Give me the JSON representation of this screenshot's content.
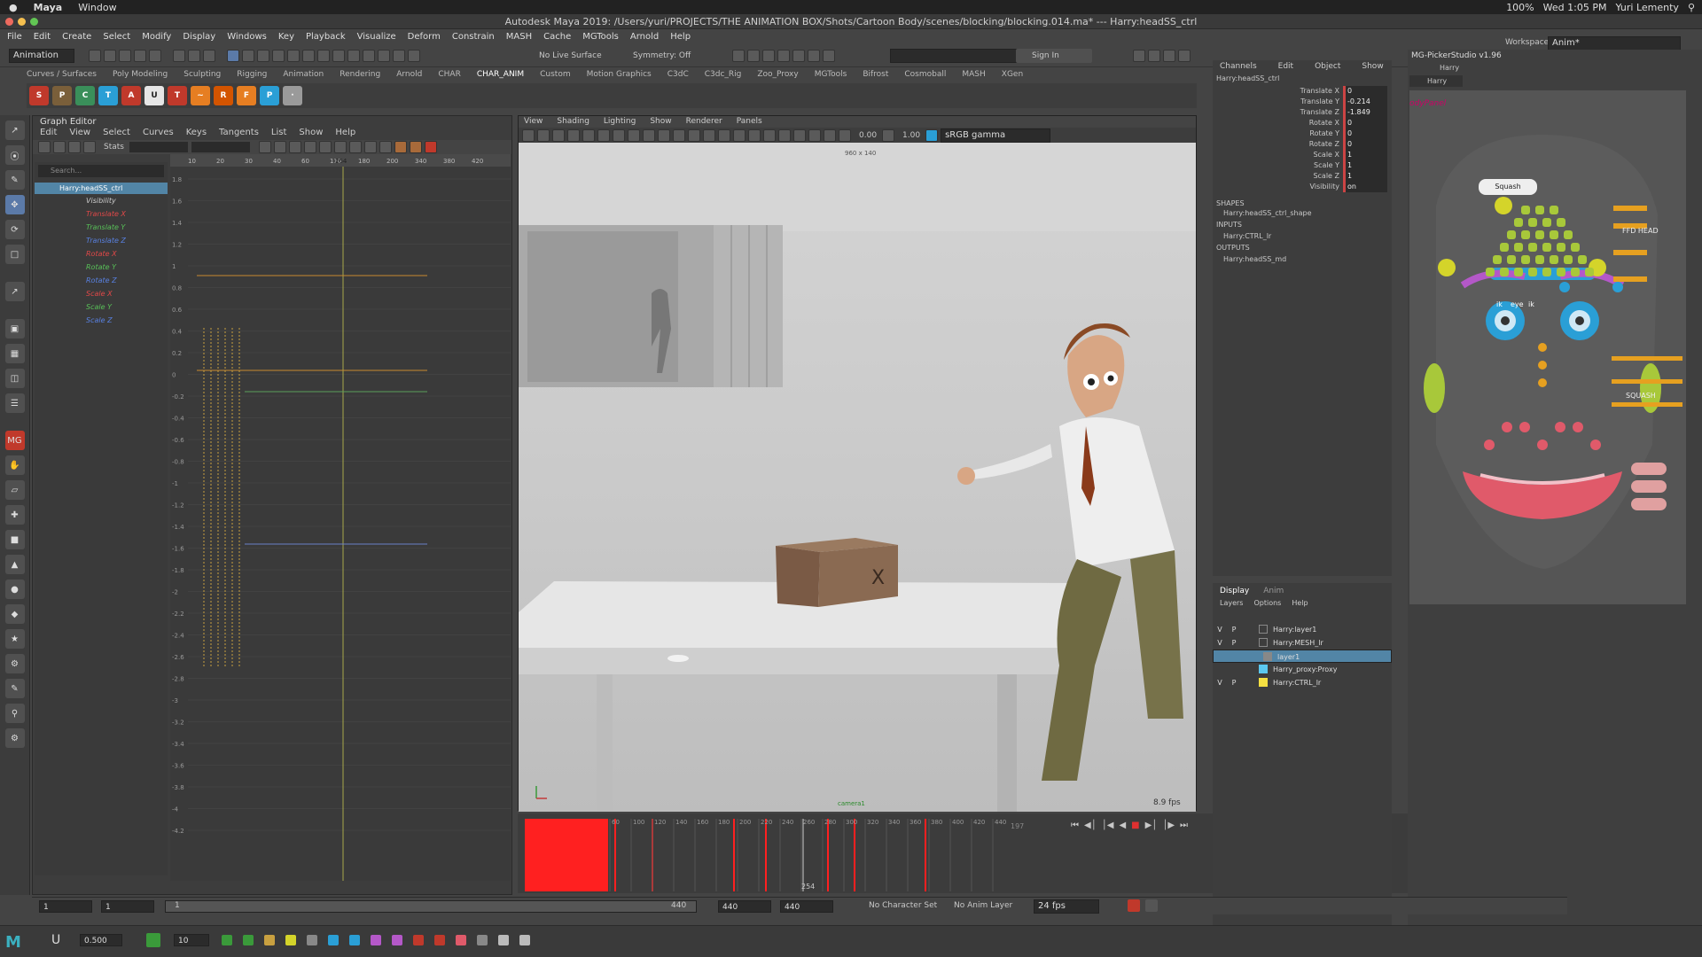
{
  "macbar": {
    "apple": "",
    "app": "Maya",
    "window": "Window",
    "datetime": "Wed 1:05 PM",
    "user": "Yuri Lementy",
    "battery": "100%"
  },
  "title": "Autodesk Maya 2019: /Users/yuri/PROJECTS/THE ANIMATION BOX/Shots/Cartoon Body/scenes/blocking/blocking.014.ma*   ---   Harry:headSS_ctrl",
  "menus": [
    "File",
    "Edit",
    "Create",
    "Select",
    "Modify",
    "Display",
    "Windows",
    "Key",
    "Playback",
    "Visualize",
    "Deform",
    "Constrain",
    "MASH",
    "Cache",
    "MGTools",
    "Arnold",
    "Help"
  ],
  "status": {
    "mode": "Animation",
    "live_surface": "No Live Surface",
    "symmetry": "Symmetry: Off",
    "sign_in": "Sign In",
    "workspace_label": "Workspace :",
    "workspace": "Anim*"
  },
  "shelf_tabs": [
    "Curves / Surfaces",
    "Poly Modeling",
    "Sculpting",
    "Rigging",
    "Animation",
    "Rendering",
    "Arnold",
    "CHAR",
    "CHAR_ANIM",
    "Custom",
    "Motion Graphics",
    "C3dC",
    "C3dc_Rig",
    "Zoo_Proxy",
    "MGTools",
    "Bifrost",
    "Cosmoball",
    "MASH",
    "XGen"
  ],
  "graph_editor": {
    "title": "Graph Editor",
    "menus": [
      "Edit",
      "View",
      "Select",
      "Curves",
      "Keys",
      "Tangents",
      "List",
      "Show",
      "Help"
    ],
    "stats": "Stats",
    "search": "Search...",
    "node": "Harry:headSS_ctrl",
    "channels": [
      {
        "label": "Visibility",
        "color": "#cccccc"
      },
      {
        "label": "Translate X",
        "color": "#e04848"
      },
      {
        "label": "Translate Y",
        "color": "#58c058"
      },
      {
        "label": "Translate Z",
        "color": "#5880e0"
      },
      {
        "label": "Rotate X",
        "color": "#e04848"
      },
      {
        "label": "Rotate Y",
        "color": "#58c058"
      },
      {
        "label": "Rotate Z",
        "color": "#5880e0"
      },
      {
        "label": "Scale X",
        "color": "#e04848"
      },
      {
        "label": "Scale Y",
        "color": "#58c058"
      },
      {
        "label": "Scale Z",
        "color": "#5880e0"
      }
    ],
    "ruler": [
      "10",
      "20",
      "30",
      "40",
      "60",
      "110",
      "180",
      "200",
      "340",
      "380",
      "420"
    ],
    "current_frame": "254",
    "yticks": [
      "1.8",
      "1.6",
      "1.4",
      "1.2",
      "1",
      "0.8",
      "0.6",
      "0.4",
      "0.2",
      "0",
      "-0.2",
      "-0.4",
      "-0.6",
      "-0.8",
      "-1",
      "-1.2",
      "-1.4",
      "-1.6",
      "-1.8",
      "-2",
      "-2.2",
      "-2.4",
      "-2.6",
      "-2.8",
      "-3",
      "-3.2",
      "-3.4",
      "-3.6",
      "-3.8",
      "-4",
      "-4.2"
    ]
  },
  "viewport": {
    "menus": [
      "View",
      "Shading",
      "Lighting",
      "Show",
      "Renderer",
      "Panels"
    ],
    "resolution": "960 x 140",
    "val1": "0.00",
    "val2": "1.00",
    "colorspace": "sRGB gamma",
    "fps": "8.9 fps",
    "cam": "camera1"
  },
  "timeline": {
    "ticks": [
      "60",
      "100",
      "120",
      "140",
      "160",
      "180",
      "200",
      "220",
      "240",
      "260",
      "280",
      "300",
      "320",
      "340",
      "360",
      "380",
      "400",
      "420",
      "440"
    ],
    "current": "254",
    "end": "197"
  },
  "channel_box": {
    "tabs": [
      "Channels",
      "Edit",
      "Object",
      "Show"
    ],
    "node": "Harry:headSS_ctrl",
    "attrs": [
      {
        "name": "Translate X",
        "value": "0"
      },
      {
        "name": "Translate Y",
        "value": "-0.214"
      },
      {
        "name": "Translate Z",
        "value": "-1.849"
      },
      {
        "name": "Rotate X",
        "value": "0"
      },
      {
        "name": "Rotate Y",
        "value": "0"
      },
      {
        "name": "Rotate Z",
        "value": "0"
      },
      {
        "name": "Scale X",
        "value": "1"
      },
      {
        "name": "Scale Y",
        "value": "1"
      },
      {
        "name": "Scale Z",
        "value": "1"
      },
      {
        "name": "Visibility",
        "value": "on"
      }
    ],
    "shapes_h": "SHAPES",
    "shape": "Harry:headSS_ctrl_shape",
    "inputs_h": "INPUTS",
    "input": "Harry:CTRL_lr",
    "outputs_h": "OUTPUTS",
    "output": "Harry:headSS_md"
  },
  "layer_editor": {
    "tabs": [
      "Display",
      "Anim"
    ],
    "menus": [
      "Layers",
      "Options",
      "Help"
    ],
    "layers": [
      {
        "v": "V",
        "p": "P",
        "name": "Harry:layer1",
        "color": "",
        "selected": false
      },
      {
        "v": "V",
        "p": "P",
        "name": "Harry:MESH_lr",
        "color": "",
        "selected": false
      },
      {
        "v": "",
        "p": "",
        "name": "layer1",
        "color": "#888888",
        "selected": true
      },
      {
        "v": "",
        "p": "",
        "name": "Harry_proxy:Proxy",
        "color": "#5bc8f0",
        "selected": false
      },
      {
        "v": "V",
        "p": "P",
        "name": "Harry:CTRL_lr",
        "color": "#f5e042",
        "selected": false
      }
    ]
  },
  "picker": {
    "title": "MG-PickerStudio v1.96",
    "char": "Harry",
    "tab": "Harry",
    "panel": "odyPanel",
    "squash_btn": "Squash",
    "ffd_label": "FFD HEAD",
    "squash_label": "SQUASH",
    "eye_label": "eye",
    "ik_label": "ik"
  },
  "range": {
    "start": "1",
    "start2": "1",
    "slider_start": "1",
    "slider_end": "440",
    "end1": "440",
    "end2": "440",
    "char_set": "No Character Set",
    "anim_layer": "No Anim Layer",
    "fps": "24 fps"
  },
  "cmd": {
    "value1": "0.500",
    "value2": "10"
  }
}
